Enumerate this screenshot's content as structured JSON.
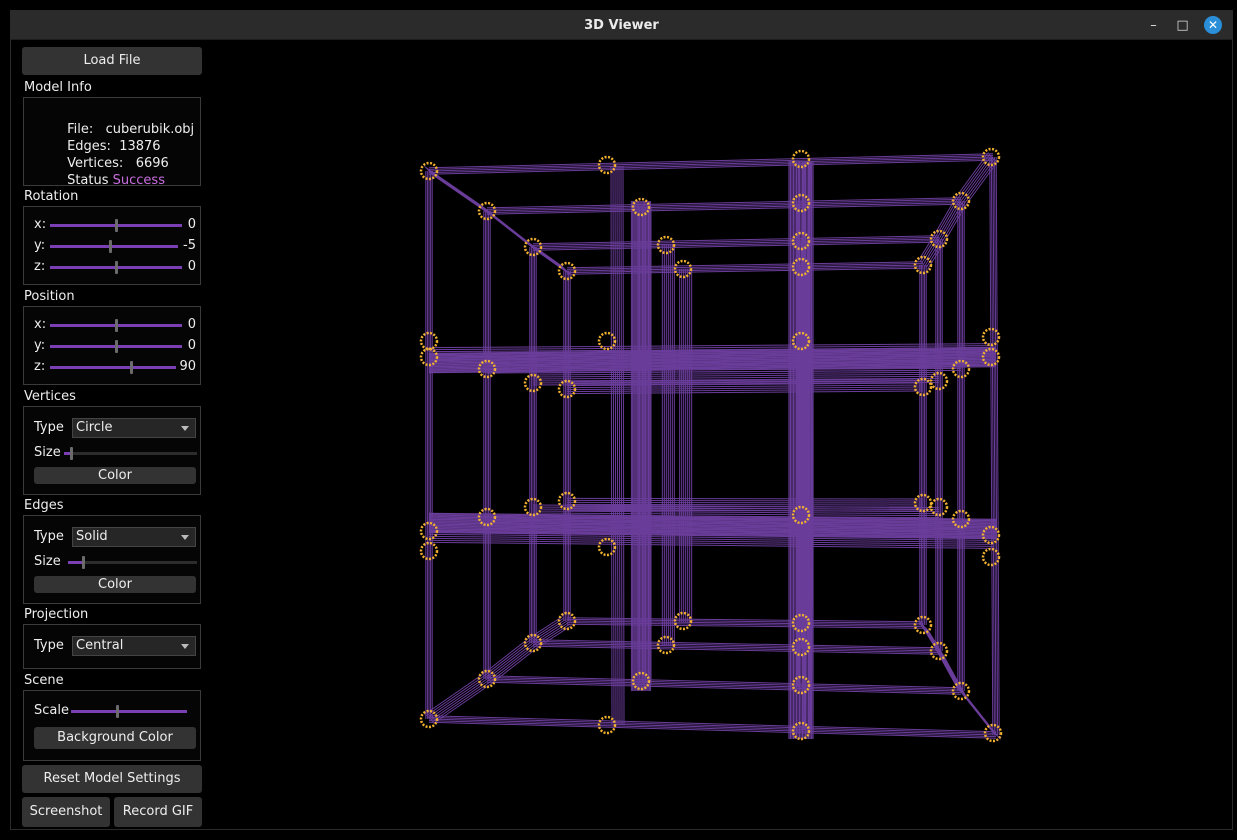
{
  "window": {
    "title": "3D Viewer"
  },
  "toolbar": {
    "load_file": "Load File"
  },
  "model_info": {
    "heading": "Model Info",
    "file_label": "File:",
    "file_value": "cuberubik.obj",
    "edges_label": "Edges:",
    "edges_value": "13876",
    "vertices_label": "Vertices:",
    "vertices_value": "6696",
    "status_label": "Status",
    "status_value": "Success"
  },
  "rotation": {
    "heading": "Rotation",
    "x": {
      "label": "x:",
      "value": "0",
      "level": 0.5
    },
    "y": {
      "label": "y:",
      "value": "-5",
      "level": 0.47
    },
    "z": {
      "label": "z:",
      "value": "0",
      "level": 0.5
    }
  },
  "position": {
    "heading": "Position",
    "x": {
      "label": "x:",
      "value": "0",
      "level": 0.5
    },
    "y": {
      "label": "y:",
      "value": "0",
      "level": 0.5
    },
    "z": {
      "label": "z:",
      "value": "90",
      "level": 0.64
    }
  },
  "vertices": {
    "heading": "Vertices",
    "type_label": "Type",
    "type_value": "Circle",
    "size_label": "Size",
    "size_level": 0.05,
    "color_button": "Color"
  },
  "edges": {
    "heading": "Edges",
    "type_label": "Type",
    "type_value": "Solid",
    "size_label": "Size",
    "size_level": 0.12,
    "color_button": "Color"
  },
  "projection": {
    "heading": "Projection",
    "type_label": "Type",
    "type_value": "Central"
  },
  "scene": {
    "heading": "Scene",
    "scale_label": "Scale",
    "scale_level": 0.4,
    "background_button": "Background Color"
  },
  "actions": {
    "reset": "Reset Model Settings",
    "screenshot": "Screenshot",
    "record_gif": "Record GIF"
  },
  "colors": {
    "edge": "#6a3d9a",
    "vertex": "#f0b030",
    "accent": "#7a3fb3",
    "success": "#c96ee0"
  }
}
